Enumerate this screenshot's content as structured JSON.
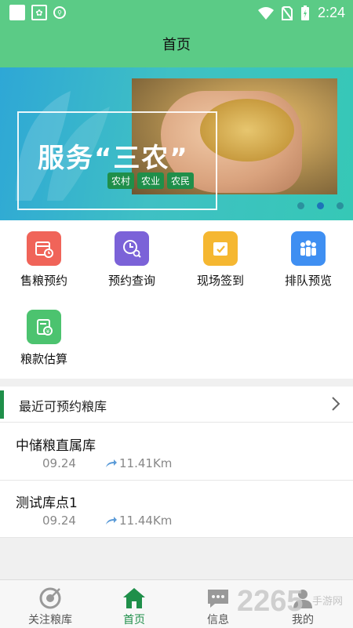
{
  "status_bar": {
    "time": "2:24"
  },
  "header": {
    "title": "首页"
  },
  "banner": {
    "title": "服务“三农”",
    "tags": [
      "农村",
      "农业",
      "农民"
    ],
    "pages": 3,
    "active_page": 2
  },
  "menu": {
    "items": [
      {
        "label": "售粮预约",
        "icon": "calendar-clock-icon",
        "color": "#f06459"
      },
      {
        "label": "预约查询",
        "icon": "clock-search-icon",
        "color": "#7b62d8"
      },
      {
        "label": "现场签到",
        "icon": "checkin-calendar-icon",
        "color": "#f5b731"
      },
      {
        "label": "排队预览",
        "icon": "queue-people-icon",
        "color": "#3f8ff2"
      },
      {
        "label": "粮款估算",
        "icon": "money-calculator-icon",
        "color": "#4cc36f"
      }
    ]
  },
  "nearby": {
    "title": "最近可预约粮库",
    "stores": [
      {
        "name": "中储粮直属库",
        "date": "09.24",
        "distance": "11.41Km"
      },
      {
        "name": "测试库点1",
        "date": "09.24",
        "distance": "11.44Km"
      }
    ]
  },
  "tabbar": {
    "tabs": [
      {
        "label": "关注粮库",
        "icon": "target-icon"
      },
      {
        "label": "首页",
        "icon": "home-icon"
      },
      {
        "label": "信息",
        "icon": "message-icon"
      },
      {
        "label": "我的",
        "icon": "user-icon"
      }
    ],
    "active_tab": "首页"
  },
  "watermark": {
    "brand": "2265",
    "sub": "手游网"
  },
  "colors": {
    "primary": "#5bcb86",
    "accent_green": "#1f8f4a"
  }
}
